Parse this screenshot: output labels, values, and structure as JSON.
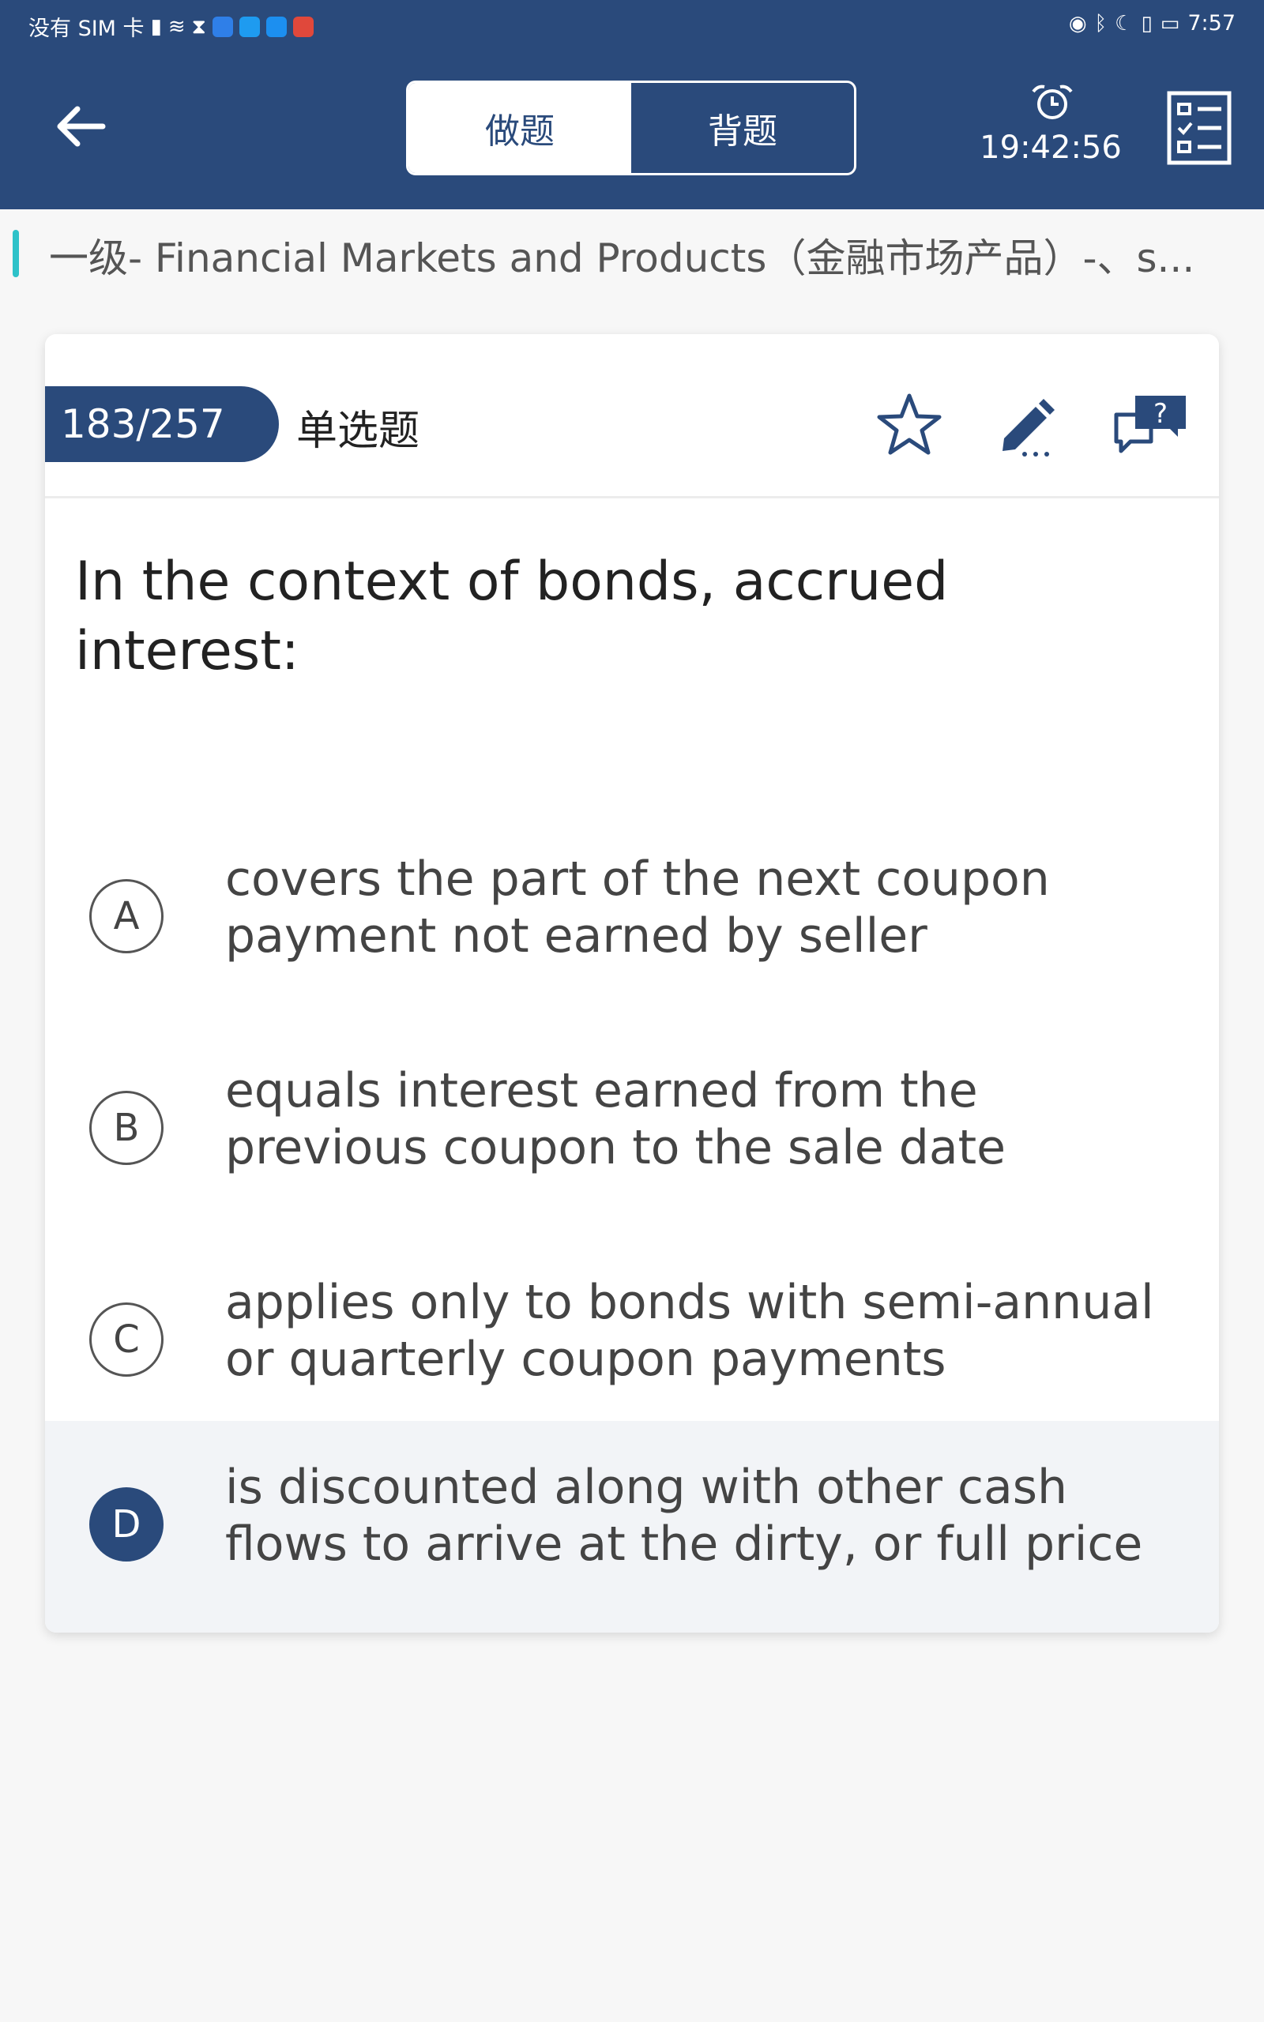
{
  "status_bar": {
    "carrier": "没有 SIM 卡",
    "time": "7:57"
  },
  "header": {
    "tabs": [
      {
        "label": "做题",
        "active": true
      },
      {
        "label": "背题",
        "active": false
      }
    ],
    "timer": "19:42:56",
    "colors": {
      "primary": "#2a4a7b",
      "accent": "#2ec2c9"
    }
  },
  "breadcrumb": {
    "text": "一级- Financial Markets and Products（金融市场产品）-、s..."
  },
  "card": {
    "counter": "183/257",
    "question_type": "单选题",
    "question": "In the context of bonds, accrued interest:",
    "options": [
      {
        "letter": "A",
        "text": "covers the part of the next coupon payment not earned by seller",
        "selected": false
      },
      {
        "letter": "B",
        "text": "equals interest earned from the previous coupon to the sale date",
        "selected": false
      },
      {
        "letter": "C",
        "text": "applies only to bonds with semi-annual or quarterly coupon payments",
        "selected": false
      },
      {
        "letter": "D",
        "text": "is discounted along with other cash flows to arrive at the dirty, or full price",
        "selected": true
      }
    ]
  },
  "icons": {
    "back": "back-arrow-icon",
    "alarm": "alarm-clock-icon",
    "answer_sheet": "answer-sheet-icon",
    "favorite": "star-icon",
    "note": "pencil-icon",
    "feedback": "question-bubble-icon"
  }
}
